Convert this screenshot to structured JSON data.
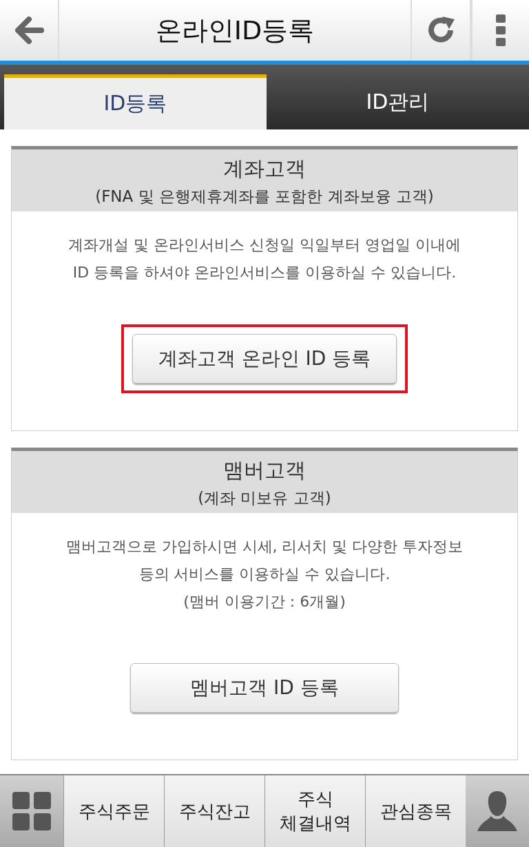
{
  "header": {
    "title": "온라인ID등록"
  },
  "tabs": [
    {
      "label": "ID등록",
      "selected": true
    },
    {
      "label": "ID관리",
      "selected": false
    }
  ],
  "sections": [
    {
      "title": "계좌고객",
      "subtitle": "(FNA 및 은행제휴계좌를 포함한 계좌보융 고객)",
      "lines": [
        "계좌개설 및 온라인서비스 신청일 익일부터 영업일 이내에",
        "ID 등록을 하셔야 온라인서비스를 이용하실 수 있습니다."
      ],
      "button": "계좌고객 온라인 ID 등록",
      "highlighted": true
    },
    {
      "title": "맴버고객",
      "subtitle": "(계좌 미보유 고객)",
      "lines": [
        "맴버고객으로 가입하시면 시세, 리서치 및 다양한 투자정보",
        "등의 서비스를 이용하실 수 있습니다.",
        "(맴버 이용기간 : 6개월)"
      ],
      "button": "멤버고객 ID 등록",
      "highlighted": false
    }
  ],
  "bottom_menu": [
    {
      "lines": [
        "주식주문"
      ]
    },
    {
      "lines": [
        "주식잔고"
      ]
    },
    {
      "lines": [
        "주식",
        "체결내역"
      ]
    },
    {
      "lines": [
        "관심종목"
      ]
    }
  ]
}
